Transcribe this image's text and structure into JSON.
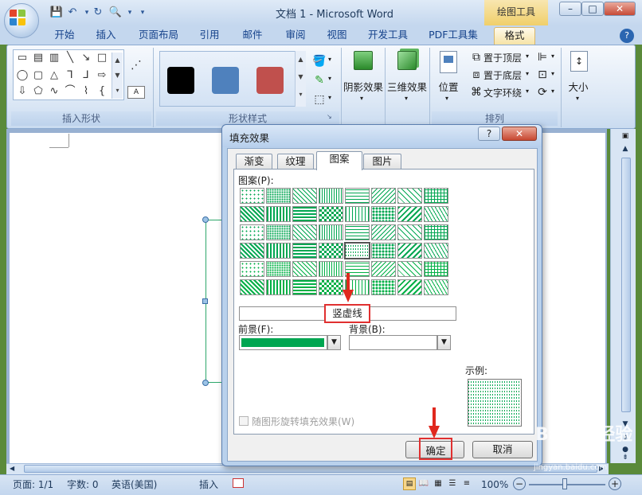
{
  "window": {
    "title": "文档 1 - Microsoft Word",
    "context_tab_group": "绘图工具",
    "controls": {
      "minimize": "–",
      "maximize": "□",
      "close": "✕"
    }
  },
  "ribbon": {
    "tabs": [
      "开始",
      "插入",
      "页面布局",
      "引用",
      "邮件",
      "审阅",
      "视图",
      "开发工具",
      "PDF工具集",
      "格式"
    ],
    "active_tab": "格式",
    "groups": {
      "insert_shapes": "插入形状",
      "shape_styles": "形状样式",
      "arrange": "排列"
    },
    "shadow_effects": "阴影效果",
    "threed_effects": "三维效果",
    "position": "位置",
    "bring_to_front": "置于顶层",
    "send_to_back": "置于底层",
    "text_wrapping": "文字环绕",
    "size": "大小",
    "style_swatches": [
      "#000000",
      "#4f81bd",
      "#c0504d"
    ]
  },
  "status_bar": {
    "page": "页面: 1/1",
    "word_count": "字数: 0",
    "language": "英语(美国)",
    "mode": "插入",
    "zoom": "100%"
  },
  "dialog": {
    "title": "填充效果",
    "help": "?",
    "close": "✕",
    "tabs": [
      "渐变",
      "纹理",
      "图案",
      "图片"
    ],
    "active_tab": "图案",
    "pattern_label": "图案(P):",
    "selected_pattern_name": "竖虚线",
    "foreground_label": "前景(F):",
    "foreground_color": "#00a651",
    "background_label": "背景(B):",
    "background_color": "#ffffff",
    "sample_label": "示例:",
    "rotate_with_shape": "随图形旋转填充效果(W)",
    "ok_button": "确定",
    "cancel_button": "取消",
    "pattern_grid": {
      "rows": 6,
      "cols": 8,
      "selected_row": 3,
      "selected_col": 4
    }
  },
  "watermark": {
    "brand": "Baidu 经验",
    "url": "jingyan.baidu.com"
  }
}
